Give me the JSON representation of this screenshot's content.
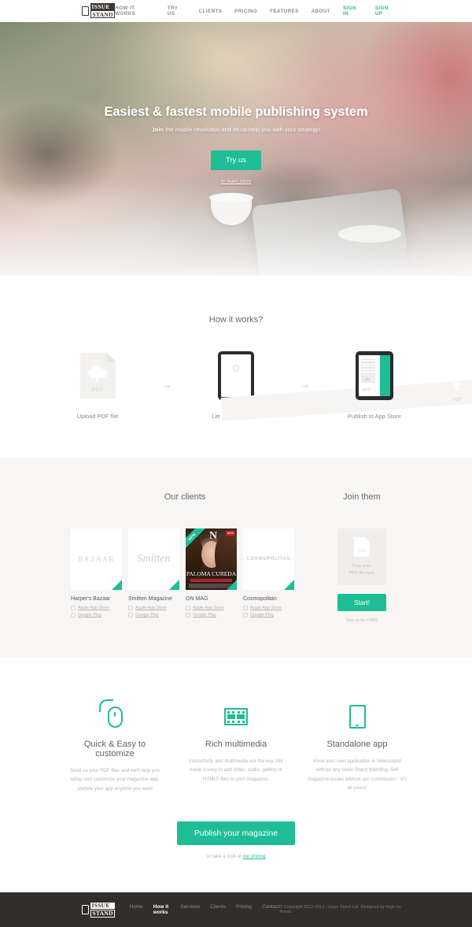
{
  "brand": {
    "line1": "ISSUE",
    "line2": "STAND"
  },
  "nav": {
    "items": [
      {
        "label": "HOW IT WORKS",
        "accent": false
      },
      {
        "label": "TRY US",
        "accent": false
      },
      {
        "label": "CLIENTS",
        "accent": false
      },
      {
        "label": "PRICING",
        "accent": false
      },
      {
        "label": "FEATURES",
        "accent": false
      },
      {
        "label": "ABOUT",
        "accent": false
      },
      {
        "label": "SIGN IN",
        "accent": true
      },
      {
        "label": "SIGN UP",
        "accent": true
      }
    ]
  },
  "hero": {
    "headline": "Easiest & fastest mobile publishing system",
    "subline_strong": "Join",
    "subline": " the mobile revolution and let us help you with your strategy!",
    "cta_label": "Try us",
    "secondary_link": "or learn more"
  },
  "howitworks": {
    "title": "How it works?",
    "arrow": "→",
    "steps": [
      {
        "label": "Upload PDF file",
        "art_label": "PDF"
      },
      {
        "label": "Let us do the work",
        "art_label": "PDF"
      },
      {
        "label": "Publish to App Store",
        "art_label": "APP"
      }
    ]
  },
  "clients": {
    "title": "Our clients",
    "store_apple": "Apple App Store",
    "store_google": "Google Play",
    "ribbon_new": "NEW",
    "items": [
      {
        "name": "Harper's Bazaar",
        "cover_text": "BAZAAR"
      },
      {
        "name": "Smitten Magazine",
        "cover_text": "Smitten"
      },
      {
        "name": "ON MAG",
        "cover_text": "PALOMA CUREDA",
        "cover_mark": "N",
        "cover_tag": "NEW"
      },
      {
        "name": "Cosmopolitan",
        "cover_text": "COSMOPOLITAN"
      }
    ]
  },
  "join": {
    "title": "Join them",
    "dropzone_label_line1": "Drop your",
    "dropzone_label_line2": "PDF file here",
    "dropzone_icon_label": "PDF",
    "start_label": "Start!",
    "free_note": "Test us for FREE"
  },
  "features": {
    "items": [
      {
        "icon": "mouse-icon",
        "title": "Quick & Easy to customize",
        "body": "Send us your PDF files and we'll help you setup and customize your magazine app. Update your app anytime you want"
      },
      {
        "icon": "film-icon",
        "title": "Rich multimedia",
        "body": "Interactivity and multimedia are the key. We made it easy to add video, audio, gallery or HTML5 files to your magazine."
      },
      {
        "icon": "tablet-icon",
        "title": "Standalone app",
        "body": "Have your own application in Newsstand without any Issue Stand branding. Sell magazine issues without our commission - it's all yours!"
      }
    ],
    "cta_label": "Publish your magazine",
    "cta_note_prefix": "or take a look at ",
    "cta_note_link": "our pricing"
  },
  "footer": {
    "links": [
      {
        "label": "Home",
        "active": false
      },
      {
        "label": "How it works",
        "active": true
      },
      {
        "label": "Services",
        "active": false
      },
      {
        "label": "Clients",
        "active": false
      },
      {
        "label": "Pricing",
        "active": false
      },
      {
        "label": "Contact",
        "active": false
      }
    ],
    "copyright": "© Copyright 2012-2013 - Issue Stand Ltd. Designed by High on Pixels."
  },
  "colors": {
    "accent": "#1fbd95",
    "dark": "#322e2b",
    "section_bg": "#f7f6f5"
  }
}
